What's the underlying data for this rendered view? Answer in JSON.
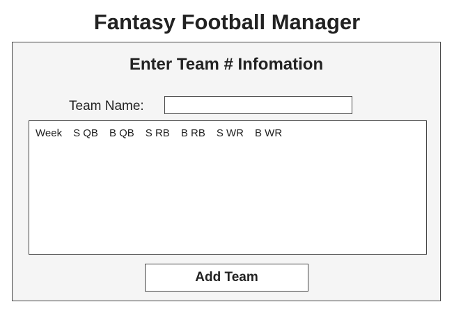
{
  "app": {
    "title": "Fantasy Football Manager"
  },
  "form": {
    "heading": "Enter Team # Infomation",
    "team_name_label": "Team Name:",
    "team_name_value": "",
    "team_name_placeholder": ""
  },
  "roster": {
    "columns": [
      "Week",
      "S QB",
      "B QB",
      "S RB",
      "B RB",
      "S WR",
      "B WR"
    ],
    "rows": []
  },
  "actions": {
    "add_team_label": "Add Team"
  }
}
